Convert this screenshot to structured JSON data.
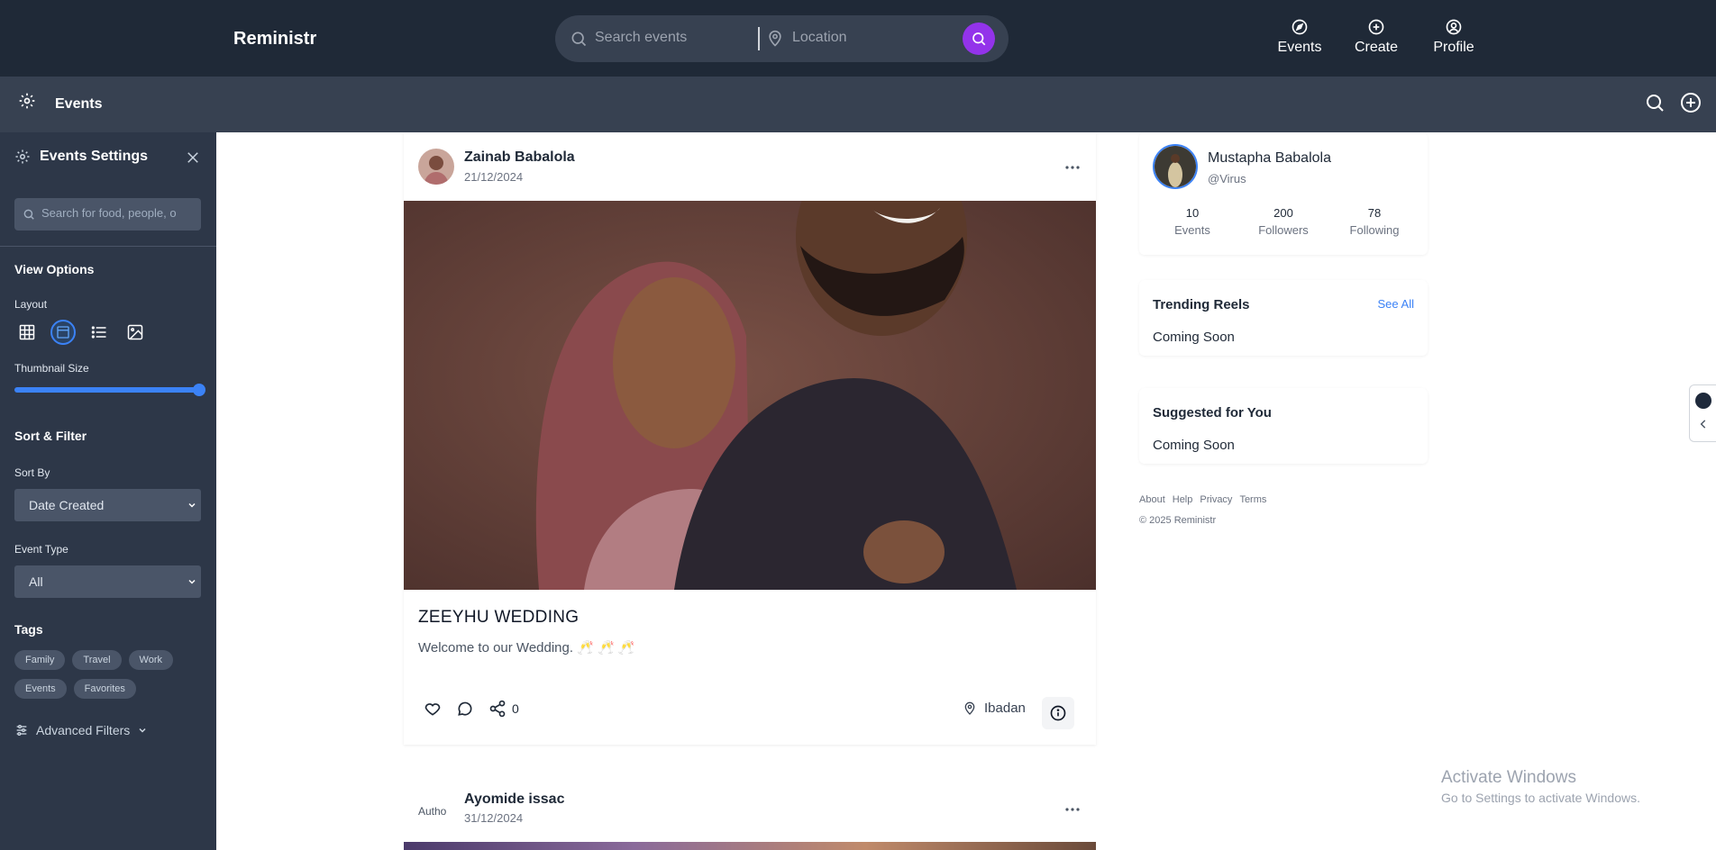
{
  "app": {
    "brand": "Reministr"
  },
  "search": {
    "events_placeholder": "Search events",
    "location_placeholder": "Location"
  },
  "nav": {
    "items": [
      {
        "label": "Events",
        "icon": "compass-icon"
      },
      {
        "label": "Create",
        "icon": "plus-circle-icon"
      },
      {
        "label": "Profile",
        "icon": "user-circle-icon"
      }
    ]
  },
  "subbar": {
    "title": "Events"
  },
  "sidebar": {
    "title": "Events Settings",
    "search_placeholder": "Search for food, people, o",
    "view_options": "View Options",
    "layout_label": "Layout",
    "thumbnail_label": "Thumbnail Size",
    "thumbnail_level": 1.0,
    "sort_filter": "Sort & Filter",
    "sort_by_label": "Sort By",
    "sort_by_value": "Date Created",
    "event_type_label": "Event Type",
    "event_type_value": "All",
    "tags_label": "Tags",
    "tags": [
      "Family",
      "Travel",
      "Work",
      "Events",
      "Favorites"
    ],
    "advanced": "Advanced Filters"
  },
  "posts": [
    {
      "author": "Zainab Babalola",
      "date": "21/12/2024",
      "title": "ZEEYHU WEDDING",
      "description": "Welcome to our Wedding. 🥂 🥂 🥂",
      "shares": "0",
      "location": "Ibadan"
    },
    {
      "author": "Ayomide issac",
      "date": "31/12/2024",
      "avatar_alt": "Autho"
    }
  ],
  "profile": {
    "name": "Mustapha Babalola",
    "handle": "@Virus",
    "stats": [
      {
        "value": "10",
        "label": "Events"
      },
      {
        "value": "200",
        "label": "Followers"
      },
      {
        "value": "78",
        "label": "Following"
      }
    ]
  },
  "trending": {
    "title": "Trending Reels",
    "see_all": "See All",
    "content": "Coming Soon"
  },
  "suggested": {
    "title": "Suggested for You",
    "content": "Coming Soon"
  },
  "footer": {
    "links": [
      "About",
      "Help",
      "Privacy",
      "Terms"
    ],
    "copyright": "© 2025 Reministr"
  },
  "watermark": {
    "line1": "Activate Windows",
    "line2": "Go to Settings to activate Windows."
  },
  "colors": {
    "nav_bg": "#1f2937",
    "sub_bg": "#374151",
    "sidebar_bg": "#2d3748",
    "accent": "#3b82f6",
    "search_button": "#9333ea"
  }
}
